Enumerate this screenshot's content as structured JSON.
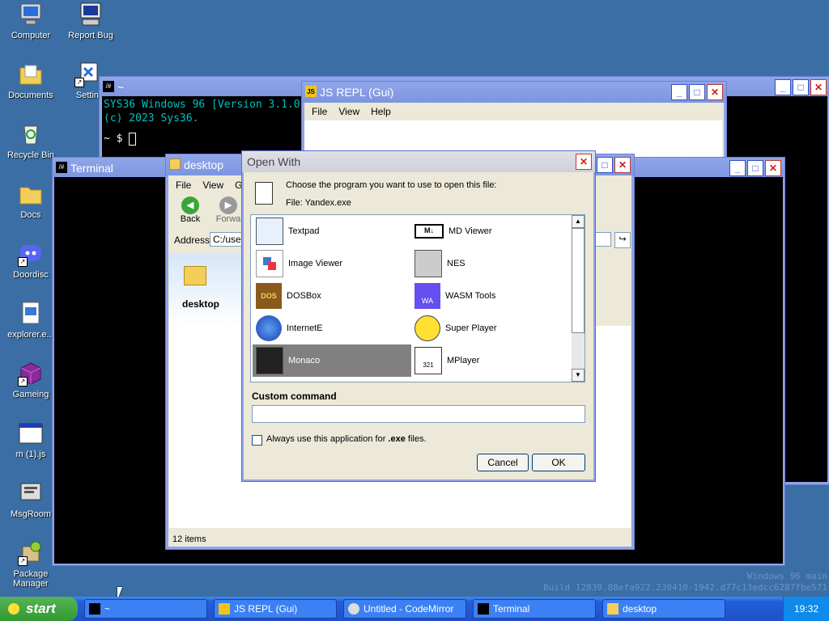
{
  "desktop": {
    "icons": [
      {
        "label": "Computer"
      },
      {
        "label": "Report Bug"
      },
      {
        "label": "Documents"
      },
      {
        "label": "Settin"
      },
      {
        "label": "Recycle Bin"
      },
      {
        "label": "Docs"
      },
      {
        "label": "Doordisc"
      },
      {
        "label": "explorer.e..."
      },
      {
        "label": "Gameing"
      },
      {
        "label": "m (1).js"
      },
      {
        "label": "MsgRoom"
      },
      {
        "label": "Package Manager"
      }
    ],
    "watermark_line1": "Windows 96 main",
    "watermark_line2": "Build 12839.88efa922.230410-1942.d77c13edcc6287fbe571"
  },
  "terminal_back": {
    "title": "~",
    "lines": [
      "SYS36 Windows 96 [Version 3.1.0",
      "(c) 2023 Sys36.",
      ""
    ],
    "prompt": "~ $ "
  },
  "terminal_front": {
    "title": "Terminal"
  },
  "js_repl": {
    "title": "JS REPL (Gui)",
    "menu": [
      "File",
      "View",
      "Help"
    ]
  },
  "explorer": {
    "title": "desktop",
    "menu": [
      "File",
      "View",
      "G"
    ],
    "back_label": "Back",
    "forward_label": "Forwa",
    "address_label": "Address",
    "address_value": "C:/user",
    "sidebar_item": "desktop",
    "status": "12 items"
  },
  "open_with": {
    "title": "Open With",
    "prompt": "Choose the program you want to use to open this file:",
    "file_label": "File: Yandex.exe",
    "programs": [
      {
        "name": "Textpad"
      },
      {
        "name": "MD Viewer"
      },
      {
        "name": "Image Viewer"
      },
      {
        "name": "NES"
      },
      {
        "name": "DOSBox"
      },
      {
        "name": "WASM Tools"
      },
      {
        "name": "InternetE"
      },
      {
        "name": "Super Player"
      },
      {
        "name": "Monaco",
        "selected": true
      },
      {
        "name": "MPlayer"
      }
    ],
    "custom_command_label": "Custom command",
    "custom_command_value": "",
    "always_use_prefix": "Always use this application for ",
    "always_use_ext": ".exe",
    "always_use_suffix": " files.",
    "cancel_label": "Cancel",
    "ok_label": "OK"
  },
  "taskbar": {
    "start_label": "start",
    "tasks": [
      {
        "label": "~"
      },
      {
        "label": "JS REPL (Gui)"
      },
      {
        "label": "Untitled - CodeMirror"
      },
      {
        "label": "Terminal"
      },
      {
        "label": "desktop"
      }
    ],
    "clock": "19:32"
  },
  "colors": {
    "desktop": "#3a6ea5",
    "titlebar": "#5069d8",
    "selection": "#808080",
    "taskbar": "#245edb",
    "start": "#329a32"
  }
}
